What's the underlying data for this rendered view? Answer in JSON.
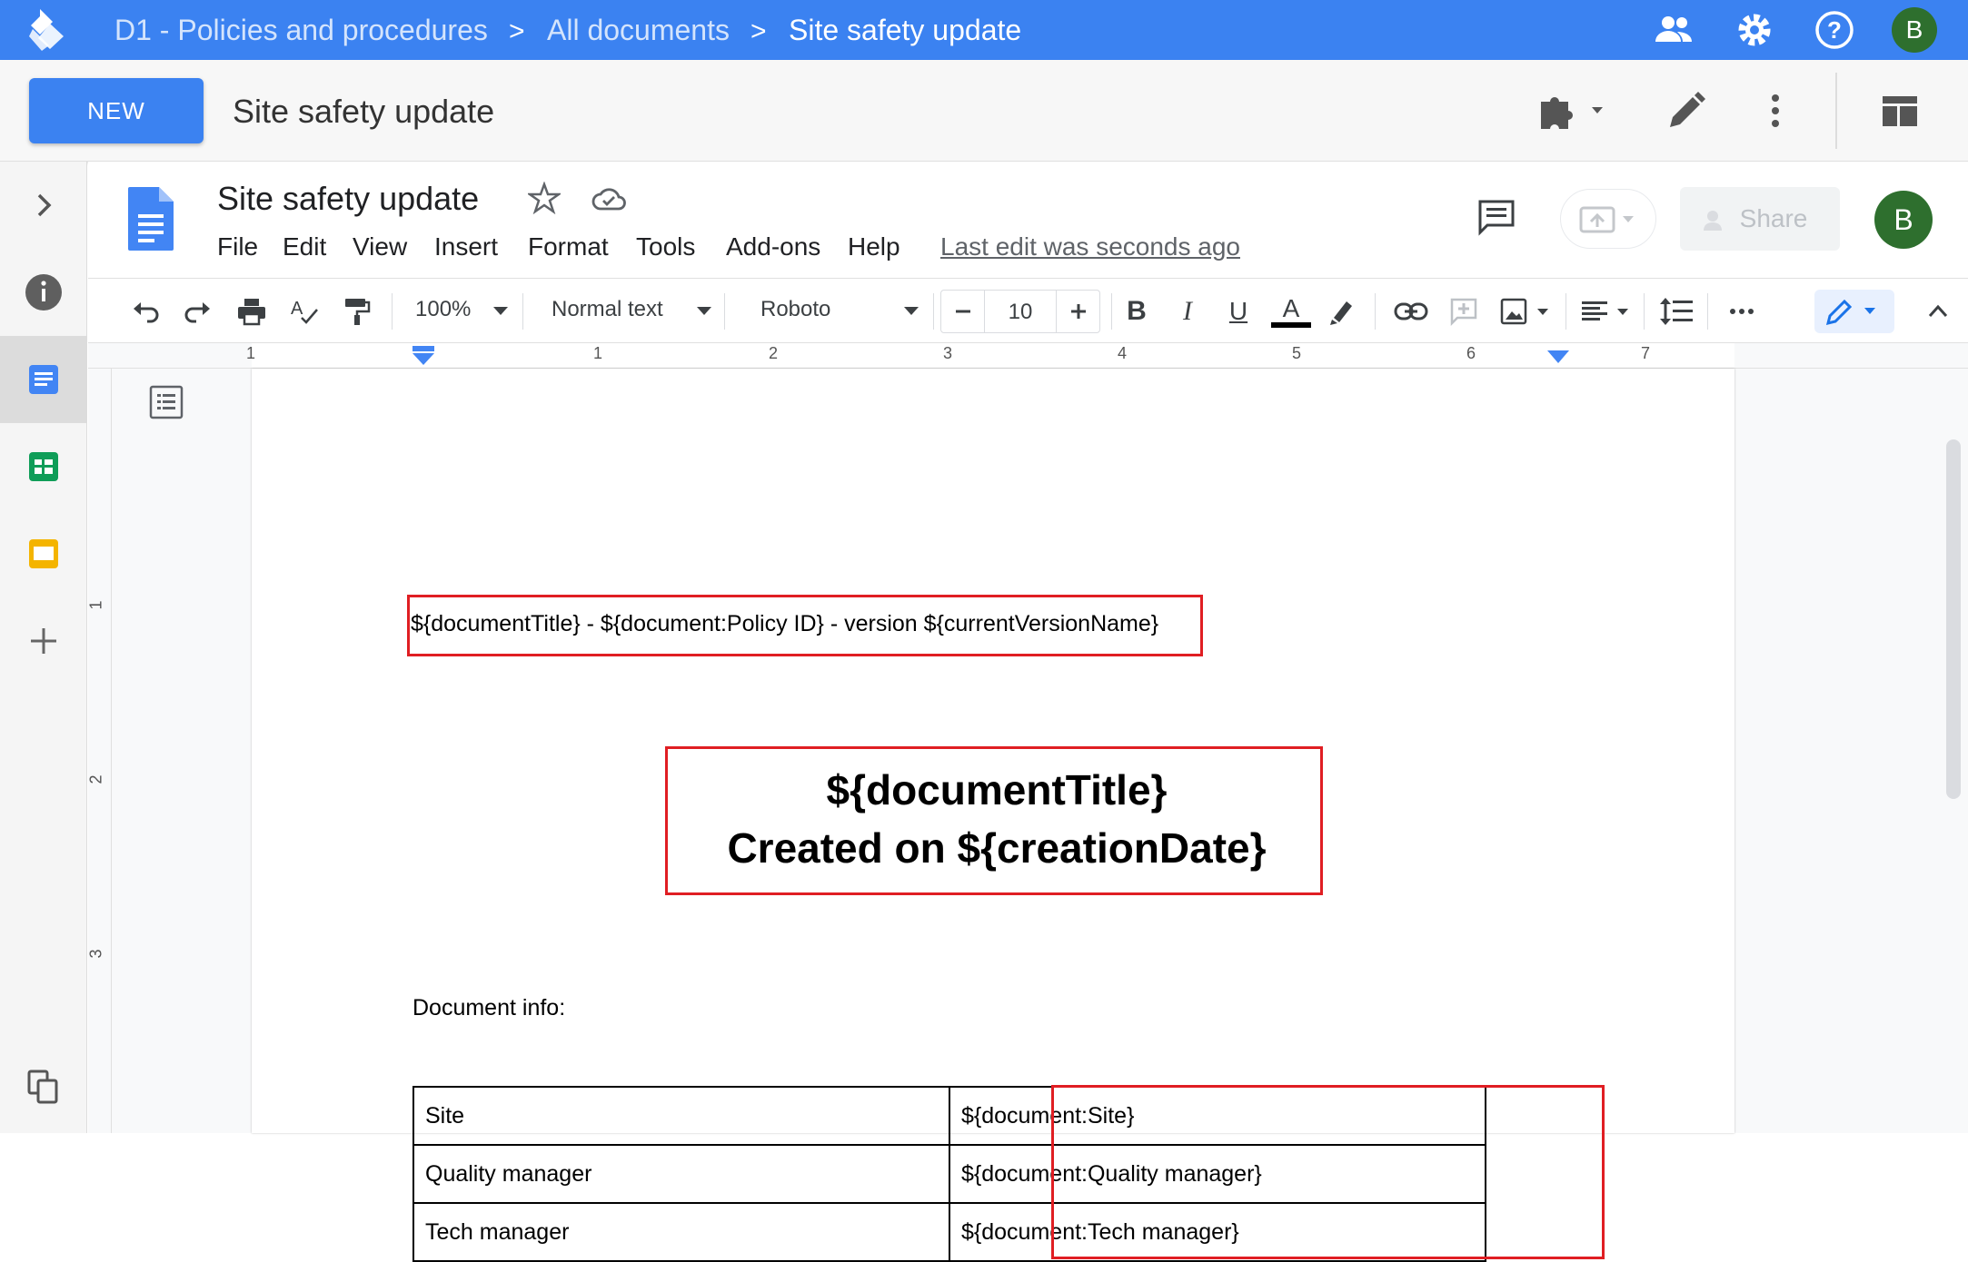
{
  "topbar": {
    "breadcrumbs": [
      "D1 - Policies and procedures",
      "All documents",
      "Site safety update"
    ],
    "separator": ">",
    "avatar_letter": "B",
    "colors": {
      "bar": "#3b82f1",
      "avatar": "#2e6f2e"
    }
  },
  "app_header": {
    "new_label": "NEW",
    "doc_title": "Site safety update"
  },
  "docs": {
    "title": "Site safety update",
    "menu": [
      "File",
      "Edit",
      "View",
      "Insert",
      "Format",
      "Tools",
      "Add-ons",
      "Help"
    ],
    "last_edit": "Last edit was seconds ago",
    "share_label": "Share",
    "avatar_letter": "B"
  },
  "toolbar": {
    "zoom": "100%",
    "style": "Normal text",
    "font": "Roboto",
    "font_size": "10"
  },
  "ruler": {
    "h_numbers": [
      "1",
      "1",
      "2",
      "3",
      "4",
      "5",
      "6",
      "7"
    ],
    "v_numbers": [
      "1",
      "2",
      "3"
    ]
  },
  "document": {
    "header_line": "${documentTitle} - ${document:Policy ID} - version ${currentVersionName}",
    "title_line1": "${documentTitle}",
    "title_line2": "Created on ${creationDate}",
    "info_label": "Document info:",
    "table": [
      [
        "Site",
        "${document:Site}"
      ],
      [
        "Quality manager",
        "${document:Quality manager}"
      ],
      [
        "Tech manager",
        "${document:Tech manager}"
      ]
    ],
    "highlight_color": "#e01e23"
  }
}
